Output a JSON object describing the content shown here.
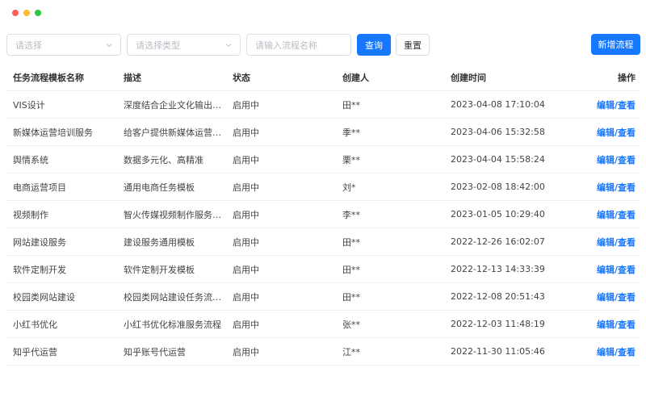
{
  "window": {
    "controls": {
      "close_color": "#ff5f57",
      "minimize_color": "#febc2e",
      "zoom_color": "#28c840"
    }
  },
  "filters": {
    "select1_placeholder": "请选择",
    "select2_placeholder": "请选择类型",
    "name_placeholder": "请输入流程名称",
    "query_label": "查询",
    "reset_label": "重置",
    "add_label": "新增流程"
  },
  "colors": {
    "accent": "#1677ff",
    "border": "#dcdfe6",
    "placeholder": "#b8bcc4"
  },
  "table": {
    "headers": [
      "任务流程模板名称",
      "描述",
      "状态",
      "创建人",
      "创建时间",
      "操作"
    ],
    "rows": [
      {
        "name": "VIS设计",
        "desc": "深度结合企业文化输出VI...",
        "status": "启用中",
        "creator": "田**",
        "time": "2023-04-08 17:10:04",
        "action": "编辑/查看"
      },
      {
        "name": "新媒体运营培训服务",
        "desc": "给客户提供新媒体运营培...",
        "status": "启用中",
        "creator": "季**",
        "time": "2023-04-06 15:32:58",
        "action": "编辑/查看"
      },
      {
        "name": "舆情系统",
        "desc": "数据多元化、高精准",
        "status": "启用中",
        "creator": "栗**",
        "time": "2023-04-04 15:58:24",
        "action": "编辑/查看"
      },
      {
        "name": "电商运营项目",
        "desc": "通用电商任务模板",
        "status": "启用中",
        "creator": "刘*",
        "time": "2023-02-08 18:42:00",
        "action": "编辑/查看"
      },
      {
        "name": "视频制作",
        "desc": "智火传媒视频制作服务流程",
        "status": "启用中",
        "creator": "李**",
        "time": "2023-01-05 10:29:40",
        "action": "编辑/查看"
      },
      {
        "name": "网站建设服务",
        "desc": "建设服务通用模板",
        "status": "启用中",
        "creator": "田**",
        "time": "2022-12-26 16:02:07",
        "action": "编辑/查看"
      },
      {
        "name": "软件定制开发",
        "desc": "软件定制开发模板",
        "status": "启用中",
        "creator": "田**",
        "time": "2022-12-13 14:33:39",
        "action": "编辑/查看"
      },
      {
        "name": "校园类网站建设",
        "desc": "校园类网站建设任务流程...",
        "status": "启用中",
        "creator": "田**",
        "time": "2022-12-08 20:51:43",
        "action": "编辑/查看"
      },
      {
        "name": "小红书优化",
        "desc": "小红书优化标准服务流程",
        "status": "启用中",
        "creator": "张**",
        "time": "2022-12-03 11:48:19",
        "action": "编辑/查看"
      },
      {
        "name": "知乎代运营",
        "desc": "知乎账号代运营",
        "status": "启用中",
        "creator": "江**",
        "time": "2022-11-30 11:05:46",
        "action": "编辑/查看"
      }
    ]
  }
}
